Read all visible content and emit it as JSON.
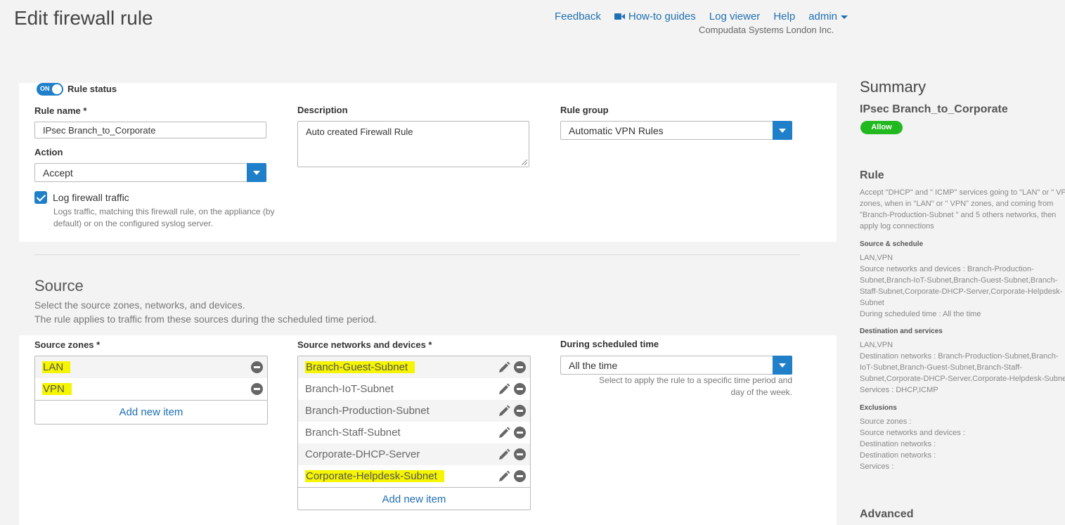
{
  "page": {
    "title": "Edit firewall rule"
  },
  "topnav": {
    "feedback": "Feedback",
    "howto": "How-to guides",
    "logviewer": "Log viewer",
    "help": "Help",
    "admin": "admin",
    "company": "Compudata Systems London Inc."
  },
  "rule": {
    "status_label": "Rule status",
    "status_toggle": "ON",
    "name_label": "Rule name *",
    "name_value": "IPsec Branch_to_Corporate",
    "description_label": "Description",
    "description_value": "Auto created Firewall Rule",
    "group_label": "Rule group",
    "group_value": "Automatic VPN Rules",
    "action_label": "Action",
    "action_value": "Accept",
    "log_label": "Log firewall traffic",
    "log_help_1": "Logs traffic, matching this firewall rule, on the appliance (by",
    "log_help_2": "default) or on the configured syslog server."
  },
  "source": {
    "title": "Source",
    "desc_1": "Select the source zones, networks, and devices.",
    "desc_2": "The rule applies to traffic from these sources during the scheduled time period.",
    "zones_label": "Source zones *",
    "zones": [
      "LAN",
      "VPN"
    ],
    "networks_label": "Source networks and devices *",
    "networks": [
      "Branch-Guest-Subnet",
      "Branch-IoT-Subnet",
      "Branch-Production-Subnet",
      "Branch-Staff-Subnet",
      "Corporate-DHCP-Server",
      "Corporate-Helpdesk-Subnet"
    ],
    "add_new": "Add new item",
    "schedule_label": "During scheduled time",
    "schedule_value": "All the time",
    "schedule_help_1": "Select to apply the rule to a specific time period and",
    "schedule_help_2": "day of the week."
  },
  "summary": {
    "title": "Summary",
    "rule_name": "IPsec Branch_to_Corporate",
    "badge": "Allow",
    "rule_heading": "Rule",
    "rule_text": [
      "Accept \"DHCP\" and \" ICMP\" services going to \"LAN\" or \" VPN\"",
      "zones, when in \"LAN\" or \" VPN\" zones, and coming from",
      "\"Branch-Production-Subnet \" and 5 others networks, then",
      "apply log connections"
    ],
    "source_heading": "Source & schedule",
    "source_text": [
      "LAN,VPN",
      "Source networks and devices : Branch-Production-",
      "Subnet,Branch-IoT-Subnet,Branch-Guest-Subnet,Branch-",
      "Staff-Subnet,Corporate-DHCP-Server,Corporate-Helpdesk-",
      "Subnet",
      "During scheduled time : All the time"
    ],
    "dest_heading": "Destination and services",
    "dest_text": [
      "LAN,VPN",
      "Destination networks : Branch-Production-Subnet,Branch-",
      "IoT-Subnet,Branch-Guest-Subnet,Branch-Staff-",
      "Subnet,Corporate-DHCP-Server,Corporate-Helpdesk-Subnet",
      "Services : DHCP,ICMP"
    ],
    "excl_heading": "Exclusions",
    "excl_text": [
      "Source zones :",
      "Source networks and devices :",
      "Destination networks :",
      "Destination networks :",
      "Services :"
    ],
    "advanced_heading": "Advanced"
  },
  "colors": {
    "accent": "#1f7fc8",
    "link": "#1f6fb2",
    "highlight": "#f5f500",
    "allow": "#22b81f"
  }
}
